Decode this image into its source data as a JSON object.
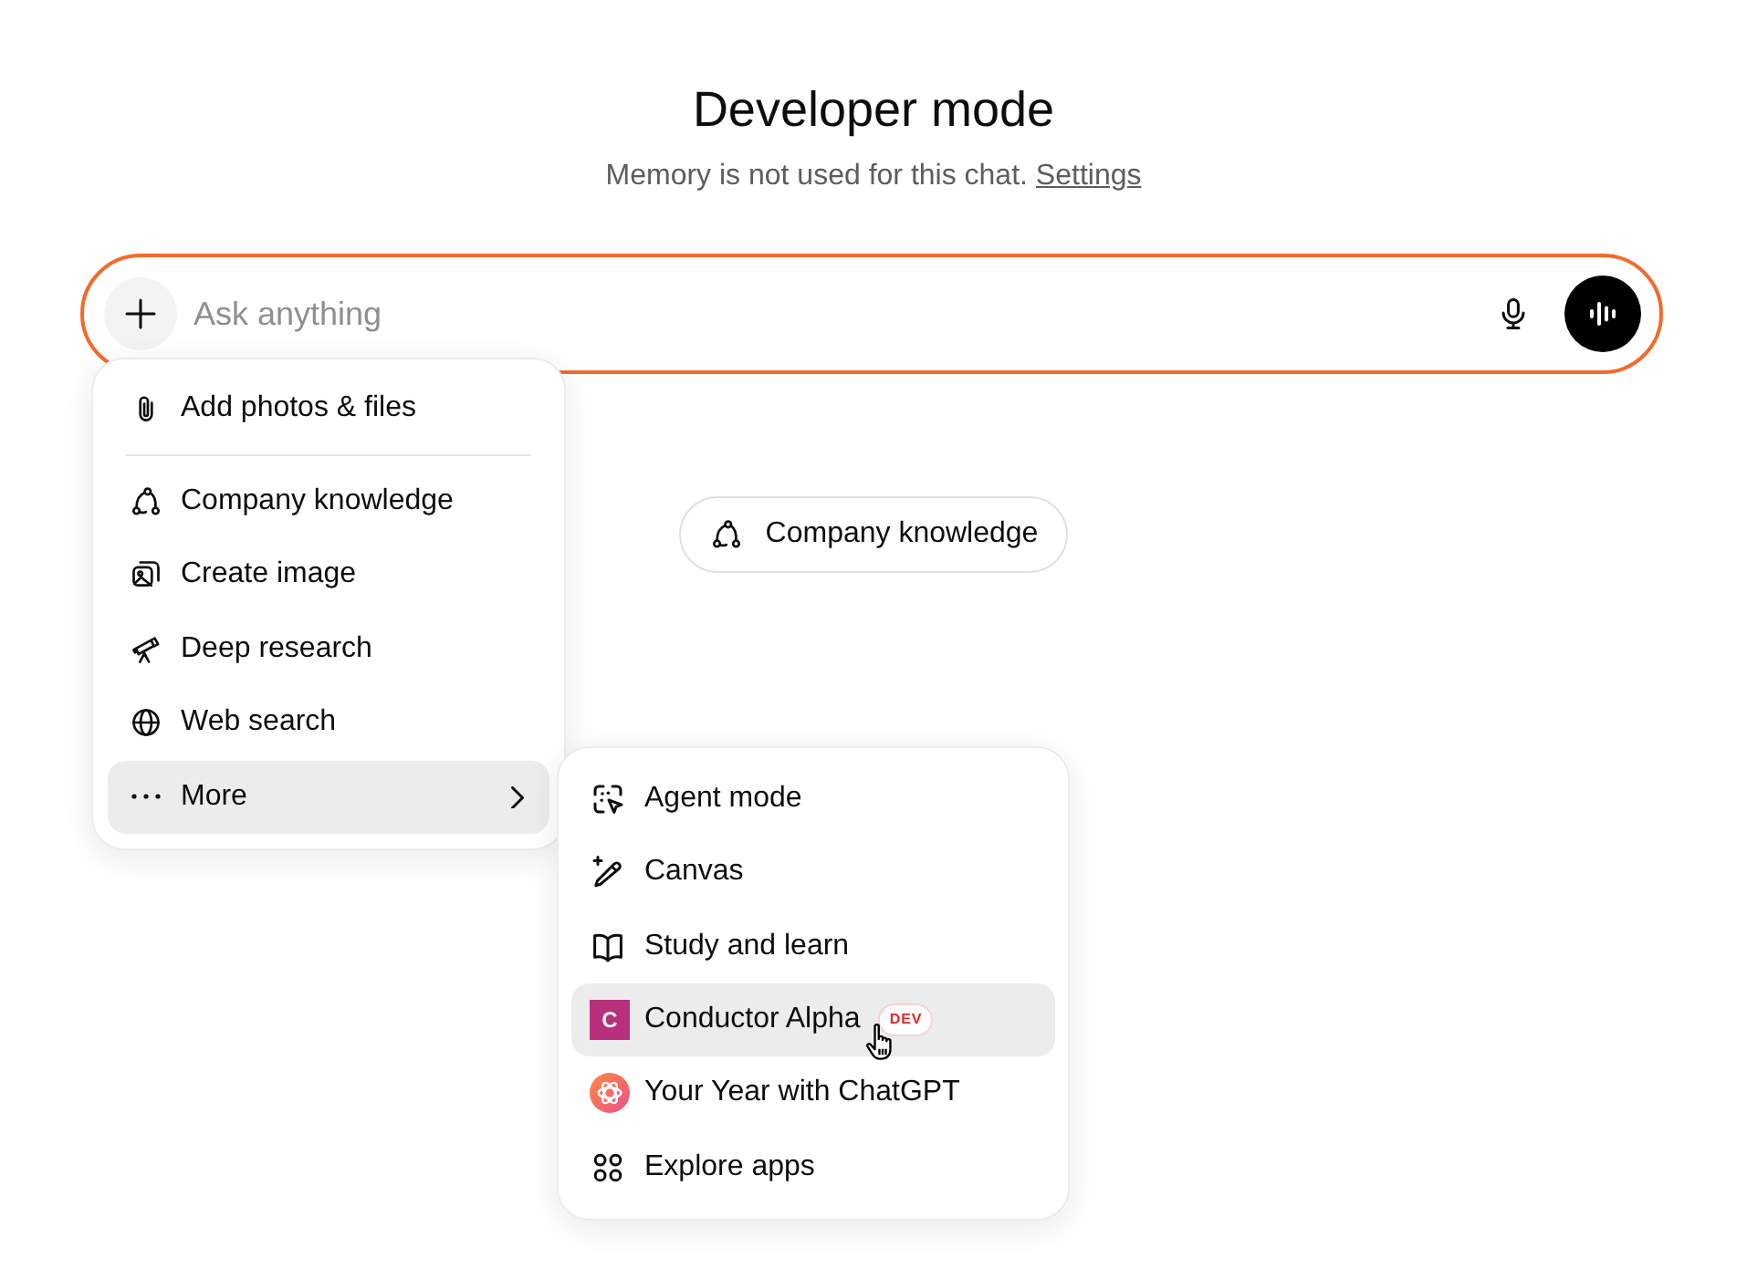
{
  "header": {
    "title": "Developer mode",
    "note": "Memory is not used for this chat.",
    "link": "Settings"
  },
  "composer": {
    "placeholder": "Ask anything",
    "focused": true
  },
  "chip": {
    "label": "Company knowledge"
  },
  "menu": {
    "sections": [
      {
        "items": [
          {
            "kind": "action",
            "label": "Add photos & files",
            "selected": false
          }
        ]
      },
      {
        "items": [
          {
            "kind": "action",
            "label": "Company knowledge",
            "selected": false
          },
          {
            "kind": "action",
            "label": "Create image",
            "selected": false
          },
          {
            "kind": "action",
            "label": "Deep research",
            "selected": false
          },
          {
            "kind": "action",
            "label": "Web search",
            "selected": false
          },
          {
            "kind": "submenu",
            "label": "More",
            "selected": true
          }
        ]
      }
    ]
  },
  "submenu": {
    "items": [
      {
        "kind": "tool",
        "label": "Agent mode",
        "selected": false
      },
      {
        "kind": "tool",
        "label": "Canvas",
        "selected": false
      },
      {
        "kind": "tool",
        "label": "Study and learn",
        "selected": false
      },
      {
        "kind": "app",
        "label": "Conductor Alpha",
        "letter": "C",
        "badge": "DEV",
        "selected": true
      },
      {
        "kind": "logo",
        "label": "Your Year with ChatGPT",
        "selected": false
      },
      {
        "kind": "tool",
        "label": "Explore apps",
        "selected": false
      }
    ]
  }
}
